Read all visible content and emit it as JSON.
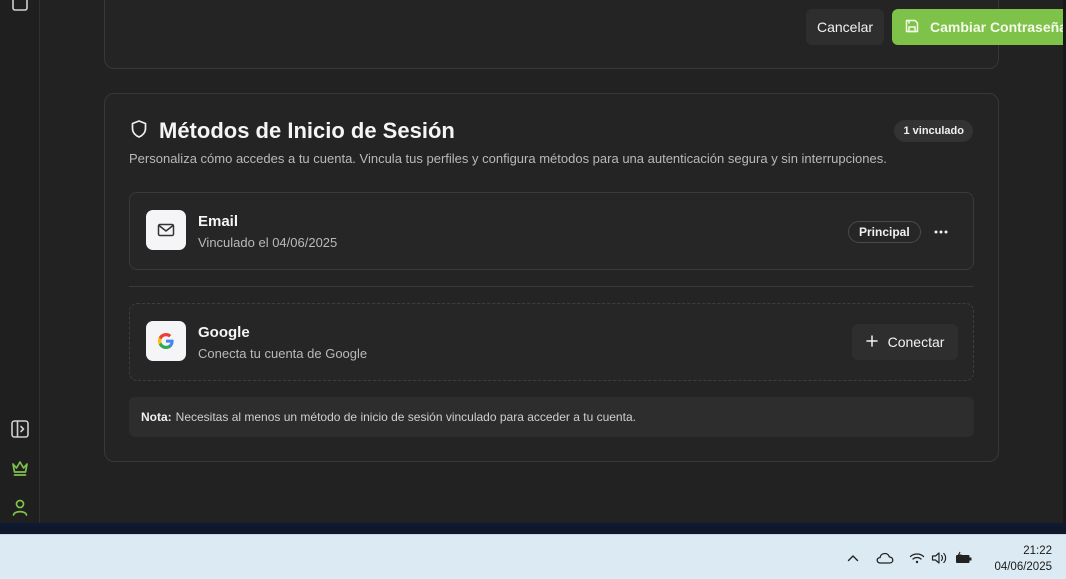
{
  "password_card": {
    "cancel_label": "Cancelar",
    "submit_label": "Cambiar Contraseña"
  },
  "login_methods": {
    "title": "Métodos de Inicio de Sesión",
    "badge": "1 vinculado",
    "subtitle": "Personaliza cómo accedes a tu cuenta. Vincula tus perfiles y configura métodos para una autenticación segura y sin interrupciones.",
    "methods": [
      {
        "name": "Email",
        "status": "Vinculado el 04/06/2025",
        "tag": "Principal",
        "icon": "mail-icon"
      },
      {
        "name": "Google",
        "status": "Conecta tu cuenta de Google",
        "action_label": "Conectar",
        "icon": "google-icon"
      }
    ],
    "note_label": "Nota:",
    "note_text": "Necesitas al menos un método de inicio de sesión vinculado para acceder a tu cuenta."
  },
  "sidebar": {
    "icons": [
      "panel-toggle-icon",
      "crown-icon",
      "user-icon"
    ]
  },
  "taskbar": {
    "time": "21:22",
    "date": "04/06/2025"
  },
  "colors": {
    "accent": "#7ec24a",
    "background": "#222222",
    "card": "#242424"
  }
}
